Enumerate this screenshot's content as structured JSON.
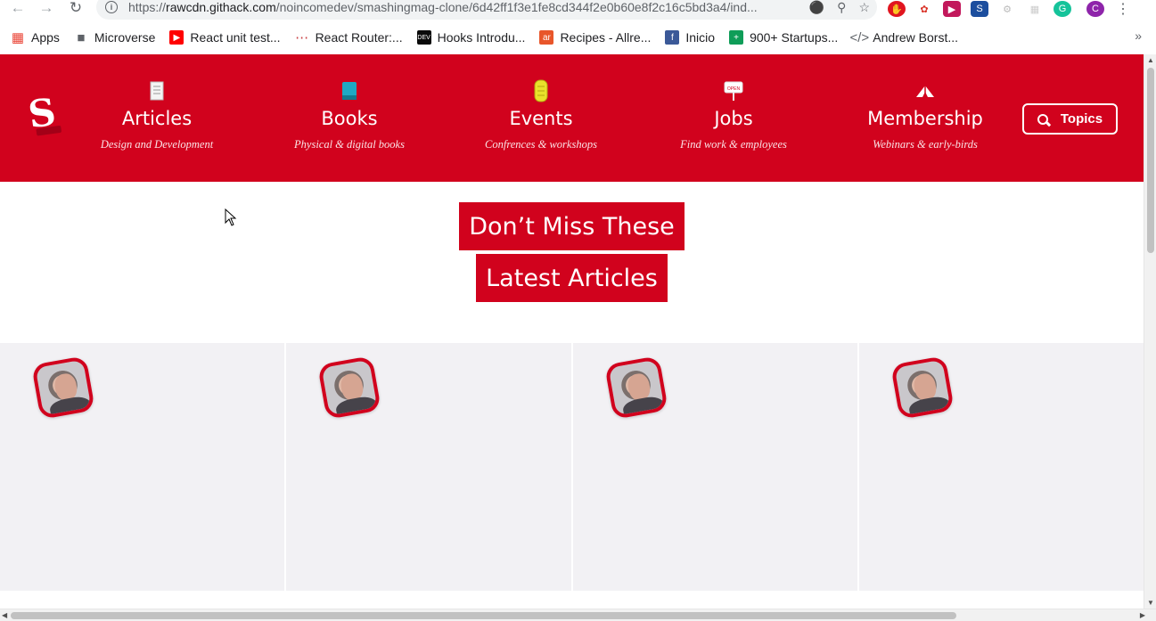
{
  "browser": {
    "url_host": "rawcdn.githack.com",
    "url_path": "/noincomedev/smashingmag-clone/6d42ff1f3e1fe8cd344f2e0b60e8f2c16c5bd3a4/ind...",
    "bookmarks": [
      {
        "label": "Apps",
        "icon": "apps-grid-icon",
        "color": "#ea4335"
      },
      {
        "label": "Microverse",
        "icon": "folder-icon",
        "color": "#5f6368"
      },
      {
        "label": "React unit test...",
        "icon": "youtube-icon",
        "color": "#ff0000"
      },
      {
        "label": "React Router:...",
        "icon": "react-router-icon",
        "color": "#ca4245"
      },
      {
        "label": "Hooks Introdu...",
        "icon": "dev-icon",
        "color": "#0a0a0a"
      },
      {
        "label": "Recipes - Allre...",
        "icon": "allrecipes-icon",
        "color": "#e8562a"
      },
      {
        "label": "Inicio",
        "icon": "facebook-icon",
        "color": "#3b5998"
      },
      {
        "label": "900+ Startups...",
        "icon": "sheets-icon",
        "color": "#0f9d58"
      },
      {
        "label": "Andrew Borst...",
        "icon": "code-icon",
        "color": "#5f6368"
      }
    ],
    "profile_initial": "C"
  },
  "site": {
    "brand_color": "#d1021d",
    "nav": [
      {
        "title": "Articles",
        "sub": "Design and Development",
        "icon": "document-icon"
      },
      {
        "title": "Books",
        "sub": "Physical & digital books",
        "icon": "book-icon"
      },
      {
        "title": "Events",
        "sub": "Confrences & workshops",
        "icon": "ticket-icon"
      },
      {
        "title": "Jobs",
        "sub": "Find work & employees",
        "icon": "open-sign-icon"
      },
      {
        "title": "Membership",
        "sub": "Webinars & early-birds",
        "icon": "tent-icon"
      }
    ],
    "topics_label": "Topics",
    "headline": "Don’t Miss These Latest Articles",
    "cards": [
      {
        "avatar": "author-avatar"
      },
      {
        "avatar": "author-avatar"
      },
      {
        "avatar": "author-avatar"
      },
      {
        "avatar": "author-avatar"
      }
    ]
  }
}
